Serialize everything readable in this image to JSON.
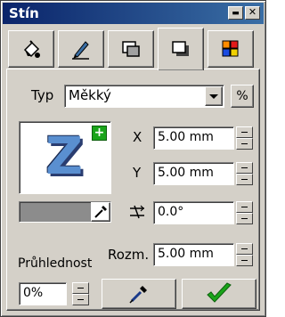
{
  "window": {
    "title": "Stín",
    "minimize_label": "▬",
    "close_label": "✕"
  },
  "tabs": [
    {
      "name": "fill-tab"
    },
    {
      "name": "outline-tab"
    },
    {
      "name": "transparency-tab"
    },
    {
      "name": "shadow-tab",
      "active": true
    },
    {
      "name": "color-tab"
    }
  ],
  "type": {
    "label": "Typ",
    "value": "Měkký",
    "percent_button": "%"
  },
  "preview": {
    "letter": "Z",
    "add_symbol": "+"
  },
  "shadow": {
    "x_label": "X",
    "x_value": "5.00 mm",
    "y_label": "Y",
    "y_value": "5.00 mm",
    "angle_value": "0.0°",
    "size_label": "Rozm.",
    "size_value": "5.00 mm"
  },
  "opacity": {
    "label": "Průhlednost",
    "value": "0%"
  },
  "colors": {
    "swatch": "#8c8c8c",
    "check": "#1aa41a",
    "title_from": "#0a246a",
    "title_to": "#3a6ea5"
  }
}
